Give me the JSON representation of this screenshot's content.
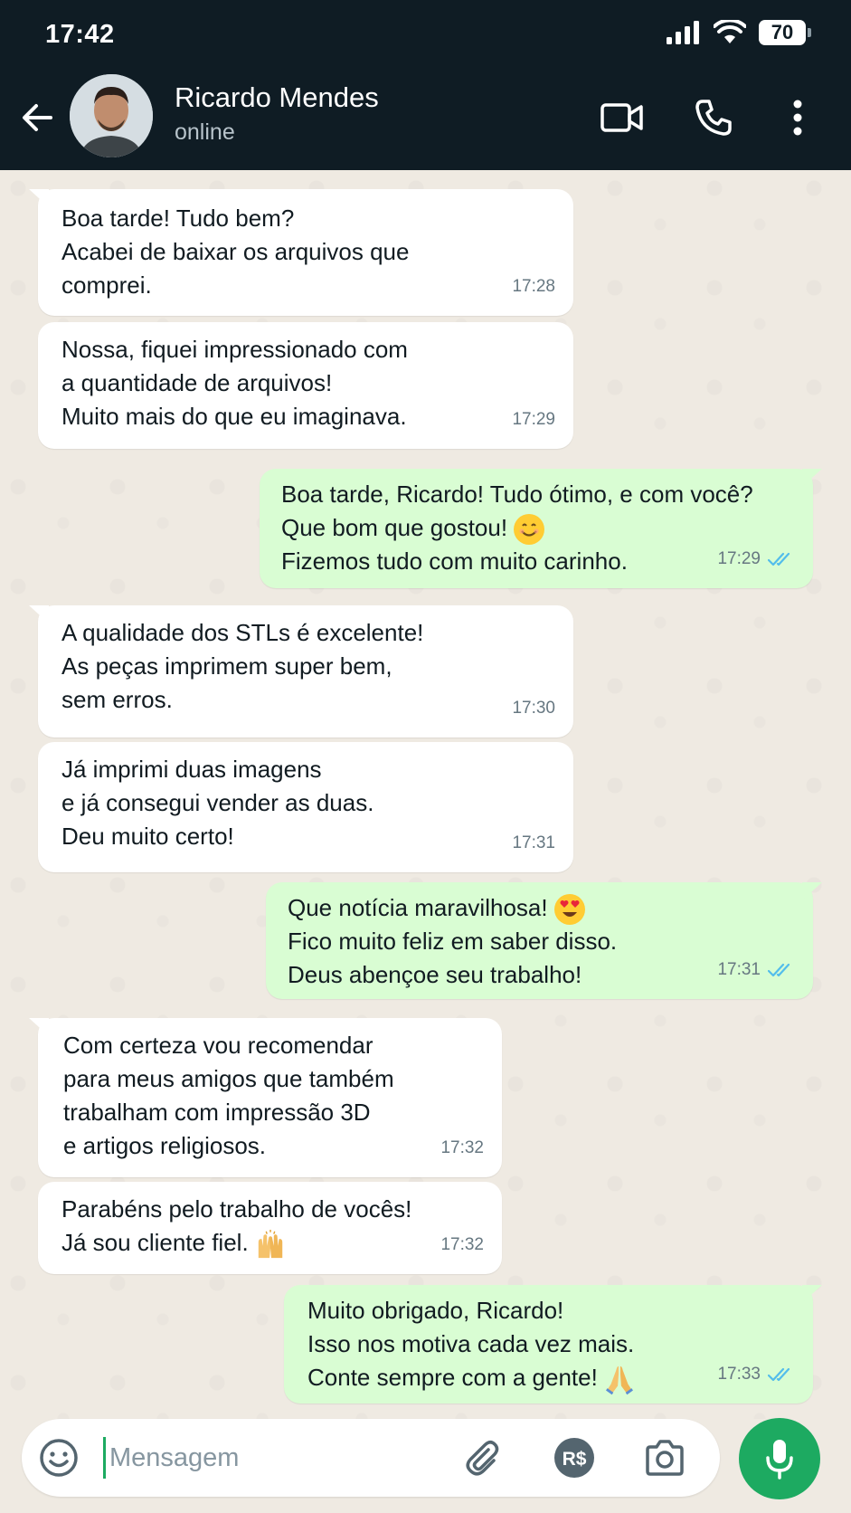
{
  "status_bar": {
    "time": "17:42",
    "battery": "70"
  },
  "header": {
    "name": "Ricardo Mendes",
    "status": "online"
  },
  "messages": [
    {
      "dir": "in",
      "text": "Boa tarde! Tudo bem?\nAcabei de baixar os arquivos que\ncomprei.",
      "time": "17:28"
    },
    {
      "dir": "in",
      "text": "Nossa, fiquei impressionado com\na quantidade de arquivos!\nMuito mais do que eu imaginava.",
      "time": "17:29"
    },
    {
      "dir": "out",
      "text_l1": "Boa tarde, Ricardo! Tudo ótimo, e com você?",
      "text_l2": "Que bom que gostou!",
      "text_l3": "Fizemos tudo com muito carinho.",
      "emoji": "smiling-face",
      "time": "17:29",
      "read": true
    },
    {
      "dir": "in",
      "text": "A qualidade dos STLs é excelente!\nAs peças imprimem super bem,\nsem erros.",
      "time": "17:30"
    },
    {
      "dir": "in",
      "text": "Já imprimi duas imagens\ne já consegui vender as duas.\nDeu muito certo!",
      "time": "17:31"
    },
    {
      "dir": "out",
      "text_l1": "Que notícia maravilhosa!",
      "text_l2": "Fico muito feliz em saber disso.",
      "text_l3": "Deus abençoe seu trabalho!",
      "emoji": "heart-eyes",
      "time": "17:31",
      "read": true
    },
    {
      "dir": "in",
      "text": "Com certeza vou recomendar\npara meus amigos que também\ntrabalham com impressão 3D\ne artigos religiosos.",
      "time": "17:32"
    },
    {
      "dir": "in",
      "text_l1": "Parabéns pelo trabalho de vocês!",
      "text_l2": "Já sou cliente fiel.",
      "emoji": "raising-hands",
      "time": "17:32"
    },
    {
      "dir": "out",
      "text_l1": "Muito obrigado, Ricardo!",
      "text_l2": "Isso nos motiva cada vez mais.",
      "text_l3": "Conte sempre com a gente!",
      "emoji": "folded-hands",
      "time": "17:33",
      "read": true
    }
  ],
  "input": {
    "placeholder": "Mensagem"
  },
  "colors": {
    "header_bg": "#0f1c24",
    "outgoing_bubble": "#d9fdd3",
    "accent_green": "#1daa61",
    "read_ticks": "#53bdeb"
  }
}
